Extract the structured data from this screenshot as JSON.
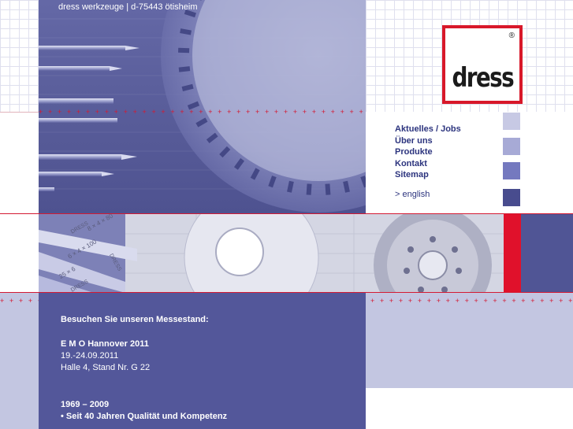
{
  "header": {
    "company_line": "dress werkzeuge | d-75443 ötisheim"
  },
  "logo": {
    "text": "dress",
    "registered": "®"
  },
  "nav": {
    "items": [
      {
        "label": "Aktuelles / Jobs"
      },
      {
        "label": "Über uns"
      },
      {
        "label": "Produkte"
      },
      {
        "label": "Kontakt"
      },
      {
        "label": "Sitemap"
      }
    ],
    "english": "> english"
  },
  "band": {
    "labels": [
      "8 × 4 × 80",
      "DRESS",
      "6 × 4 × 100",
      "DRESS",
      "25 × 6",
      "DRESS"
    ]
  },
  "info": {
    "messe_heading": "Besuchen Sie unseren Messestand:",
    "event_name": "E M O Hannover 2011",
    "event_dates": "19.-24.09.2011",
    "event_location": "Halle 4, Stand Nr. G 22",
    "years": "1969 – 2009",
    "tagline": "• Seit 40 Jahren Qualität und Kompetenz"
  },
  "colors": {
    "brand_red": "#d8182a",
    "nav_blue": "#2c347e",
    "panel_blue": "#53579a",
    "light_lavender": "#c3c6e1",
    "square_1": "#c7c9e4",
    "square_2": "#a7aad6",
    "square_3": "#7479bf",
    "square_4": "#484c8e"
  }
}
